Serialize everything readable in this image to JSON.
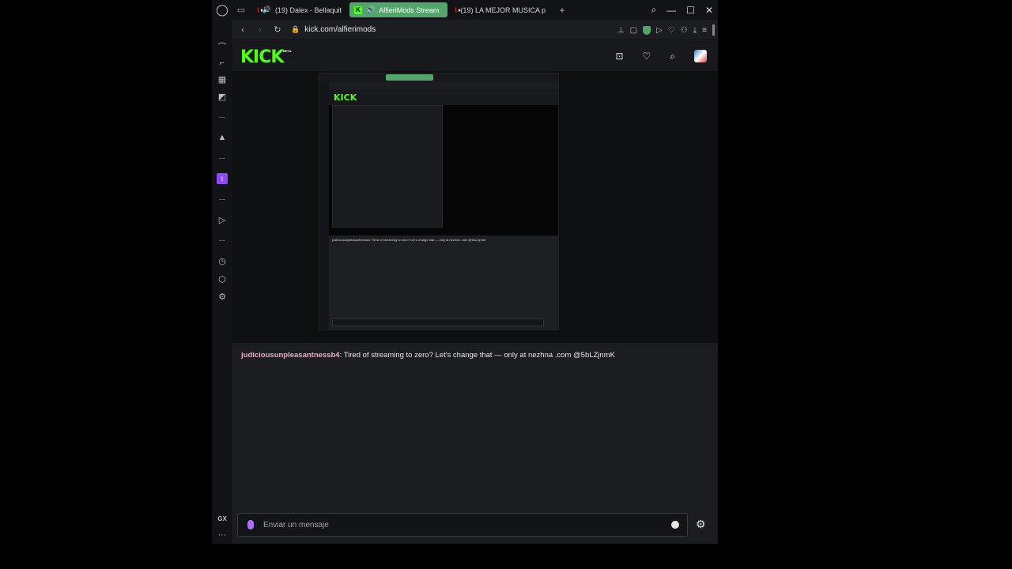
{
  "tabs": [
    {
      "label": "(19) Dalex - Bellaquit",
      "icon": "youtube-icon",
      "active": false
    },
    {
      "label": "AlfieriMods Stream",
      "icon": "kick-icon",
      "active": true
    },
    {
      "label": "(19) LA MEJOR MUSICA p",
      "icon": "youtube-icon",
      "active": false
    }
  ],
  "address": {
    "url": "kick.com/alfierimods"
  },
  "kick": {
    "logo": "KICK",
    "beta": "BETA"
  },
  "nested": {
    "logo": "KICK",
    "message": "judiciousunpleasantnessb4: Tired of streaming to zero? Let's change that — only at nezhna .com @5bLZjnmK"
  },
  "chat": {
    "username": "judiciousunpleasantnessb4",
    "separator": ": ",
    "message": "Tired of streaming to zero? Let's change that — only at nezhna .com @5bLZjnmK",
    "placeholder": "Enviar un mensaje"
  },
  "sidebar": {
    "gx_label": "GX",
    "more_label": "···"
  },
  "colors": {
    "kick_green": "#53fc18",
    "active_tab": "#53a56c",
    "username": "#f3a9c0"
  }
}
